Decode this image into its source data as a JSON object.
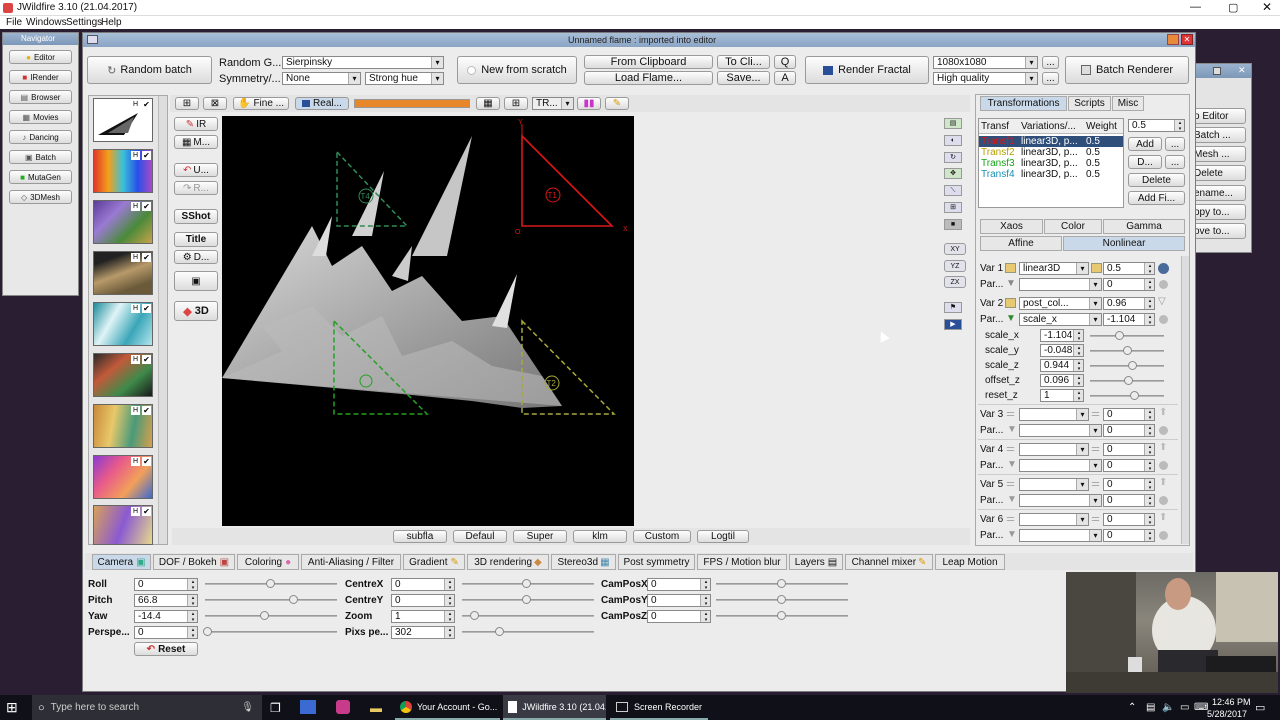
{
  "window": {
    "title": "JWildfire 3.10 (21.04.2017)",
    "menu": [
      "File",
      "Windows",
      "Settings",
      "Help"
    ]
  },
  "navigator": {
    "title": "Navigator",
    "items": [
      "Editor",
      "IRender",
      "Browser",
      "Movies",
      "Dancing",
      "Batch",
      "MutaGen",
      "3DMesh"
    ]
  },
  "editor": {
    "title": "Unnamed flame : imported into editor",
    "random_batch": "Random batch",
    "random_gen_label": "Random G...",
    "random_gen_value": "Sierpinsky",
    "symmetry_label": "Symmetry/...",
    "symmetry_value": "None",
    "hue_value": "Strong hue",
    "new_from_scratch": "New from scratch",
    "from_clipboard": "From Clipboard",
    "load_flame": "Load Flame...",
    "to_clip": "To Cli...",
    "save": "Save...",
    "q": "Q",
    "a": "A",
    "render_fractal": "Render Fractal",
    "resolution": "1080x1080",
    "quality": "High quality",
    "more": "...",
    "batch_renderer": "Batch Renderer"
  },
  "preview_toolbar": {
    "fine": "Fine ...",
    "real": "Real...",
    "tr": "TR..."
  },
  "left_tools": {
    "ir": "IR",
    "m": "M...",
    "u": "U...",
    "r": "R...",
    "sshot": "SShot",
    "title": "Title",
    "d": "D...",
    "three_d": "3D"
  },
  "triangles": {
    "t1": "T1",
    "t2": "T2",
    "t4": "T4",
    "axis_x": "X",
    "axis_y": "Y",
    "axis_o": "O"
  },
  "side_axis": {
    "xy": "XY",
    "yz": "YZ",
    "zx": "ZX"
  },
  "bottom_buttons": [
    "subfla",
    "Defaul",
    "Super",
    "klm",
    "Custom",
    "Logtil"
  ],
  "right_panel": {
    "tabs": [
      "Transformations",
      "Scripts",
      "Misc"
    ],
    "headers": [
      "Transf",
      "Variations/...",
      "Weight"
    ],
    "rows": [
      {
        "name": "Transf1",
        "var": "linear3D, p...",
        "weight": "0.5",
        "color": "#d81818"
      },
      {
        "name": "Transf2",
        "var": "linear3D, p...",
        "weight": "0.5",
        "color": "#b8a000"
      },
      {
        "name": "Transf3",
        "var": "linear3D, p...",
        "weight": "0.5",
        "color": "#18a018"
      },
      {
        "name": "Transf4",
        "var": "linear3D, p...",
        "weight": "0.5",
        "color": "#1890b8"
      }
    ],
    "weight_value": "0.5",
    "add": "Add",
    "dots": "...",
    "d": "D...",
    "delete": "Delete",
    "add_fi": "Add Fi...",
    "subtabs_top": [
      "Xaos",
      "Color",
      "Gamma"
    ],
    "subtabs_bottom": [
      "Affine",
      "Nonlinear"
    ],
    "var1": {
      "label": "Var 1",
      "name": "linear3D",
      "value": "0.5"
    },
    "par1": {
      "label": "Par...",
      "value": "0"
    },
    "var2": {
      "label": "Var 2",
      "name": "post_col...",
      "value": "0.96"
    },
    "par2": {
      "label": "Par...",
      "name": "scale_x",
      "value": "-1.104"
    },
    "params": [
      {
        "name": "scale_x",
        "value": "-1.104"
      },
      {
        "name": "scale_y",
        "value": "-0.048"
      },
      {
        "name": "scale_z",
        "value": "0.944"
      },
      {
        "name": "offset_z",
        "value": "0.096"
      },
      {
        "name": "reset_z",
        "value": "1"
      }
    ],
    "empty_vars": [
      {
        "var": "Var 3",
        "par": "Par...",
        "v": "0",
        "p": "0"
      },
      {
        "var": "Var 4",
        "par": "Par...",
        "v": "0",
        "p": "0"
      },
      {
        "var": "Var 5",
        "par": "Par...",
        "v": "0",
        "p": "0"
      },
      {
        "var": "Var 6",
        "par": "Par...",
        "v": "0",
        "p": "0"
      }
    ]
  },
  "bottom_tabs": [
    "Camera",
    "DOF / Bokeh",
    "Coloring",
    "Anti-Aliasing / Filter",
    "Gradient",
    "3D rendering",
    "Stereo3d",
    "Post symmetry",
    "FPS / Motion blur",
    "Layers",
    "Channel mixer",
    "Leap Motion"
  ],
  "camera": {
    "roll": {
      "label": "Roll",
      "value": "0"
    },
    "pitch": {
      "label": "Pitch",
      "value": "66.8"
    },
    "yaw": {
      "label": "Yaw",
      "value": "-14.4"
    },
    "persp": {
      "label": "Perspe...",
      "value": "0"
    },
    "reset": "Reset",
    "centrex": {
      "label": "CentreX",
      "value": "0"
    },
    "centrey": {
      "label": "CentreY",
      "value": "0"
    },
    "zoom": {
      "label": "Zoom",
      "value": "1"
    },
    "pixs": {
      "label": "Pixs pe...",
      "value": "302"
    },
    "camposx": {
      "label": "CamPosX",
      "value": "0"
    },
    "camposy": {
      "label": "CamPosY",
      "value": "0"
    },
    "camposz": {
      "label": "CamPosZ",
      "value": "0"
    }
  },
  "back_window": {
    "items": [
      "o Editor",
      "Batch ...",
      "Mesh ...",
      "Delete",
      "ename...",
      "opy to...",
      "ove to..."
    ]
  },
  "taskbar": {
    "search_placeholder": "Type here to search",
    "apps": [
      "Your Account - Go...",
      "JWildfire 3.10 (21.04...",
      "Screen Recorder"
    ],
    "time": "12:46 PM",
    "date": "5/28/2017"
  }
}
